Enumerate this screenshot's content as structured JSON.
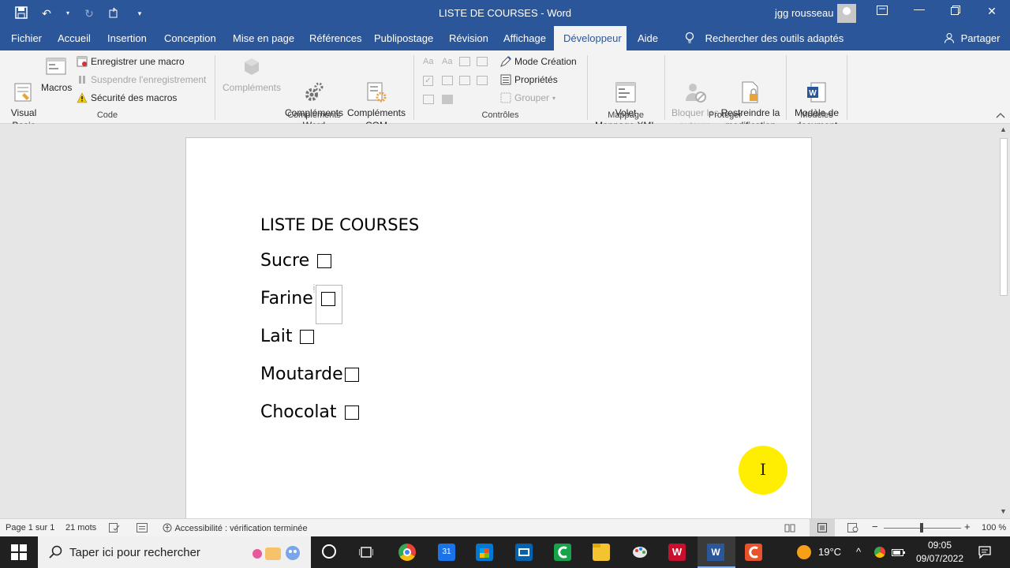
{
  "window": {
    "title": "LISTE DE COURSES  -  Word",
    "user": "jgg rousseau"
  },
  "tabs": [
    {
      "label": "Fichier"
    },
    {
      "label": "Accueil"
    },
    {
      "label": "Insertion"
    },
    {
      "label": "Conception"
    },
    {
      "label": "Mise en page"
    },
    {
      "label": "Références"
    },
    {
      "label": "Publipostage"
    },
    {
      "label": "Révision"
    },
    {
      "label": "Affichage"
    },
    {
      "label": "Développeur"
    },
    {
      "label": "Aide"
    }
  ],
  "tell_me": "Rechercher des outils adaptés",
  "share": "Partager",
  "ribbon": {
    "code": {
      "visual_basic": "Visual\nBasic",
      "macros": "Macros",
      "record_macro": "Enregistrer une macro",
      "pause_record": "Suspendre l'enregistrement",
      "macro_security": "Sécurité des macros",
      "group": "Code"
    },
    "addins": {
      "complements": "Compléments",
      "word_addins": "Compléments\nWord",
      "com_addins": "Compléments\nCOM",
      "group": "Compléments"
    },
    "controls": {
      "design_mode": "Mode Création",
      "properties": "Propriétés",
      "group_btn": "Grouper",
      "group": "Contrôles"
    },
    "mapping": {
      "xml_pane": "Volet\nMappage XML",
      "group": "Mappage"
    },
    "protect": {
      "block_authors": "Bloquer les\nauteurs",
      "restrict": "Restreindre la\nmodification",
      "group": "Protéger"
    },
    "templates": {
      "doc_template": "Modèle de\ndocument",
      "group": "Modèles"
    }
  },
  "document": {
    "heading": "LISTE DE COURSES",
    "items": [
      {
        "label": "Sucre",
        "checked": false
      },
      {
        "label": "Farine",
        "checked": false
      },
      {
        "label": "Lait",
        "checked": false
      },
      {
        "label": "Moutarde",
        "checked": false
      },
      {
        "label": "Chocolat",
        "checked": false
      }
    ],
    "checkbox_glyph": "☐"
  },
  "status": {
    "page": "Page 1 sur 1",
    "words": "21 mots",
    "accessibility": "Accessibilité : vérification terminée",
    "zoom": "100 %"
  },
  "taskbar": {
    "search_placeholder": "Taper ici pour rechercher",
    "temperature": "19°C",
    "time": "09:05",
    "date": "09/07/2022"
  },
  "colors": {
    "word_blue": "#2b579a",
    "ribbon_bg": "#f3f3f3",
    "highlight": "#ffee00"
  }
}
